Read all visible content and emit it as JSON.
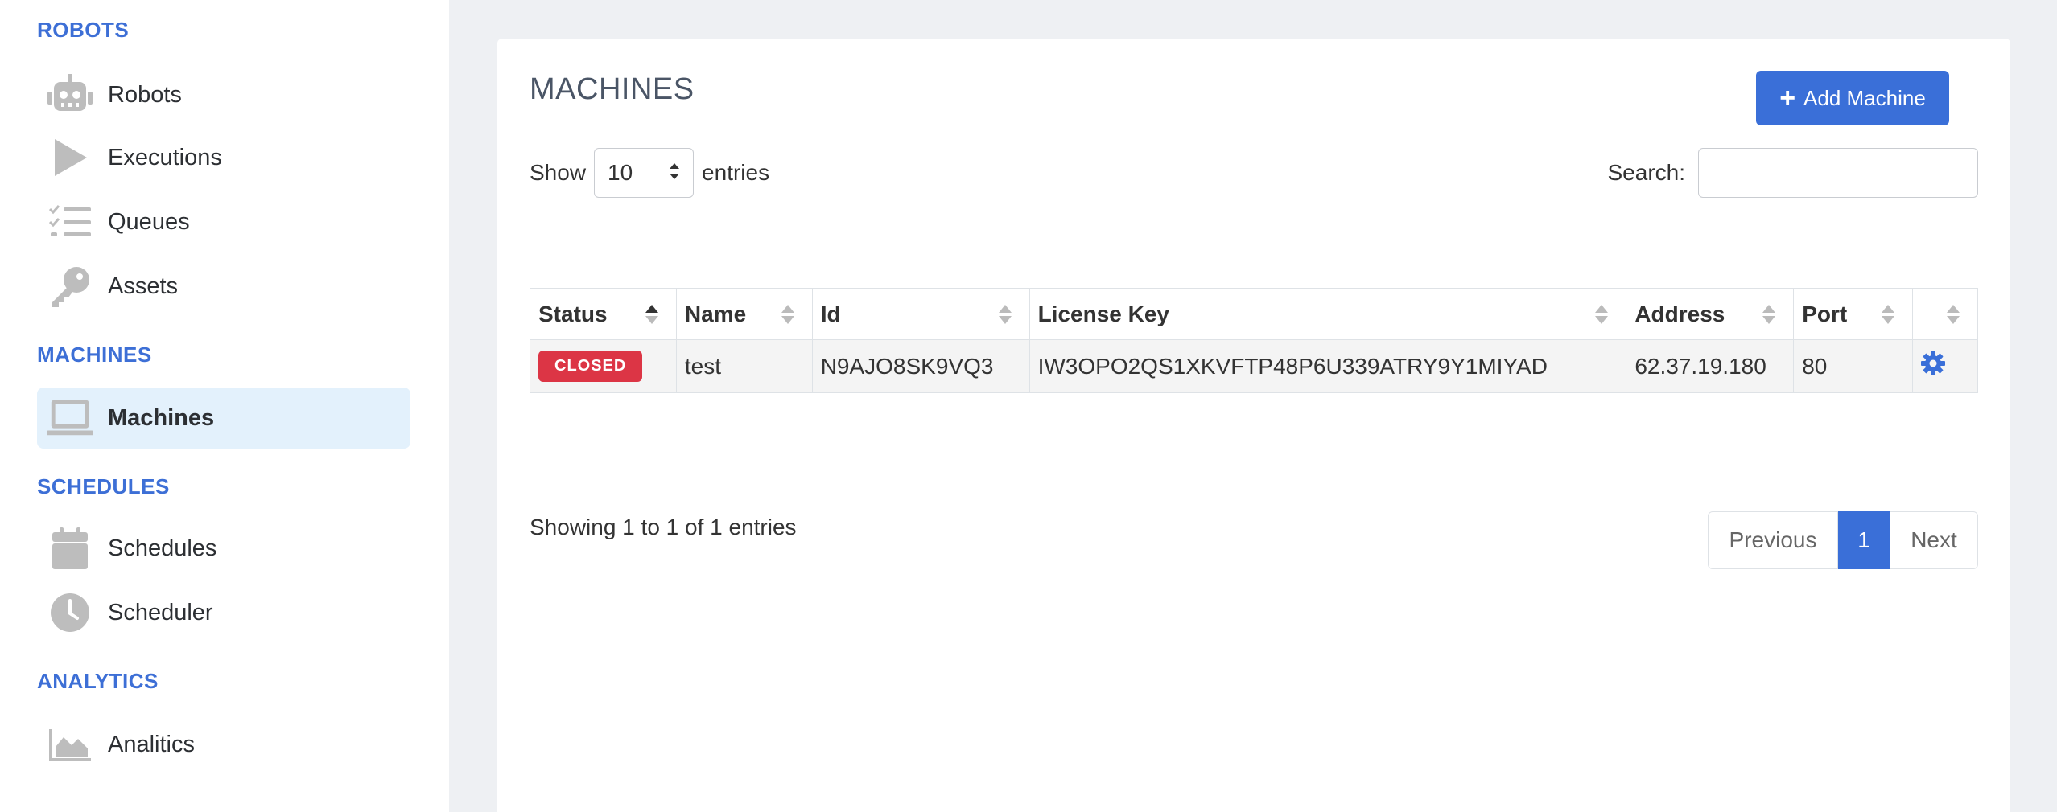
{
  "sidebar": {
    "sections": [
      {
        "title": "ROBOTS",
        "items": [
          {
            "label": "Robots",
            "icon": "robot-icon"
          },
          {
            "label": "Executions",
            "icon": "play-icon"
          },
          {
            "label": "Queues",
            "icon": "list-check-icon"
          },
          {
            "label": "Assets",
            "icon": "key-icon"
          }
        ]
      },
      {
        "title": "MACHINES",
        "items": [
          {
            "label": "Machines",
            "icon": "laptop-icon",
            "active": true
          }
        ]
      },
      {
        "title": "SCHEDULES",
        "items": [
          {
            "label": "Schedules",
            "icon": "calendar-icon"
          },
          {
            "label": "Scheduler",
            "icon": "clock-icon"
          }
        ]
      },
      {
        "title": "ANALYTICS",
        "items": [
          {
            "label": "Analitics",
            "icon": "area-chart-icon"
          }
        ]
      }
    ]
  },
  "main": {
    "title": "MACHINES",
    "add_button": "Add Machine",
    "show_label": "Show",
    "entries_value": "10",
    "entries_label": "entries",
    "search_label": "Search:",
    "search_value": "",
    "table": {
      "columns": [
        "Status",
        "Name",
        "Id",
        "License Key",
        "Address",
        "Port",
        ""
      ],
      "rows": [
        {
          "status": "CLOSED",
          "name": "test",
          "id": "N9AJO8SK9VQ3",
          "license_key": "IW3OPO2QS1XKVFTP48P6U339ATRY9Y1MIYAD",
          "address": "62.37.19.180",
          "port": "80"
        }
      ]
    },
    "info": "Showing 1 to 1 of 1 entries",
    "pagination": {
      "previous": "Previous",
      "current": "1",
      "next": "Next"
    }
  },
  "colors": {
    "accent": "#3a6fd8",
    "section_title": "#3d6fd6",
    "active_bg": "#e3f1fc",
    "status_closed": "#dc3545",
    "icon_gray": "#bdbdbd"
  }
}
